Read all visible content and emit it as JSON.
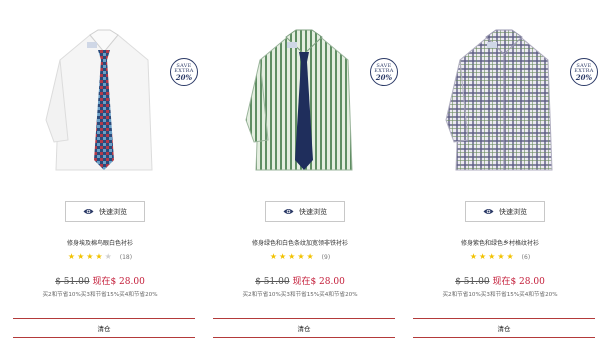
{
  "products": [
    {
      "badge": {
        "line1": "SAVE",
        "line2": "EXTRA",
        "line3": "20%"
      },
      "quick_view_label": "快速浏览",
      "title": "修身埃及棉鸟眼白色衬衫",
      "rating": 4,
      "rating_count": "(18)",
      "old_price": "$ 51.00",
      "new_price": "现在$ 28.00",
      "promo": "买2和节省10%买3和节省15%买4和节省20%",
      "clearance_label": "清仓",
      "shirt": {
        "base": "#f7f7f7",
        "stripe": "none",
        "tie": "check"
      }
    },
    {
      "badge": {
        "line1": "SAVE",
        "line2": "EXTRA",
        "line3": "20%"
      },
      "quick_view_label": "快速浏览",
      "title": "修身绿色和白色条纹加宽领非铁衬衫",
      "rating": 5,
      "rating_count": "(9)",
      "old_price": "$ 51.00",
      "new_price": "现在$ 28.00",
      "promo": "买2和节省10%买3和节省15%买4和节省20%",
      "clearance_label": "清仓",
      "shirt": {
        "base": "#dfe9dc",
        "stripe": "#4d7a52",
        "tie": "navy"
      }
    },
    {
      "badge": {
        "line1": "SAVE",
        "line2": "EXTRA",
        "line3": "20%"
      },
      "quick_view_label": "快速浏览",
      "title": "修身紫色和绿色乡村格纹衬衫",
      "rating": 5,
      "rating_count": "(6)",
      "old_price": "$ 51.00",
      "new_price": "现在$ 28.00",
      "promo": "买2和节省10%买3和节省15%买4和节省20%",
      "clearance_label": "清仓",
      "shirt": {
        "base": "#e8e6ee",
        "stripe": "#4a4a6e",
        "tie": "none"
      }
    }
  ],
  "colors": {
    "price_new": "#c41e3a",
    "star": "#f2c200",
    "clearance_border": "#b33a3a",
    "badge": "#2b3a67"
  }
}
